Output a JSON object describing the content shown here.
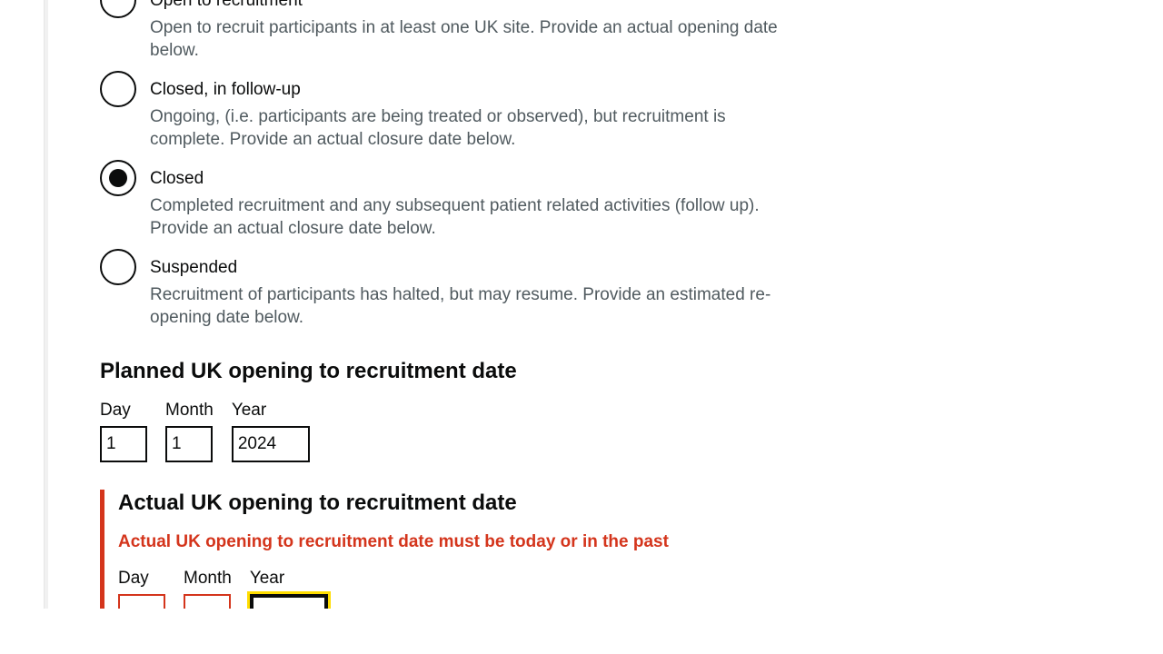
{
  "status_options": [
    {
      "label": "Open to recruitment",
      "hint": "Open to recruit participants in at least one UK site. Provide an actual opening date below.",
      "checked": false
    },
    {
      "label": "Closed, in follow-up",
      "hint": "Ongoing, (i.e. participants are being treated or observed), but recruitment is complete. Provide an actual closure date below.",
      "checked": false
    },
    {
      "label": "Closed",
      "hint": "Completed recruitment and any subsequent patient related activities (follow up). Provide an actual closure date below.",
      "checked": true
    },
    {
      "label": "Suspended",
      "hint": "Recruitment of participants has halted, but may resume. Provide an estimated re-opening date below.",
      "checked": false
    }
  ],
  "planned_date": {
    "heading": "Planned UK opening to recruitment date",
    "day_label": "Day",
    "month_label": "Month",
    "year_label": "Year",
    "day_value": "1",
    "month_value": "1",
    "year_value": "2024"
  },
  "actual_date": {
    "heading": "Actual UK opening to recruitment date",
    "error": "Actual UK opening to recruitment date must be today or in the past",
    "day_label": "Day",
    "month_label": "Month",
    "year_label": "Year",
    "day_value": "",
    "month_value": "",
    "year_value": ""
  },
  "colors": {
    "error": "#d4351c",
    "focus": "#ffdd00",
    "text": "#0b0c0c",
    "hint": "#505a5f"
  }
}
